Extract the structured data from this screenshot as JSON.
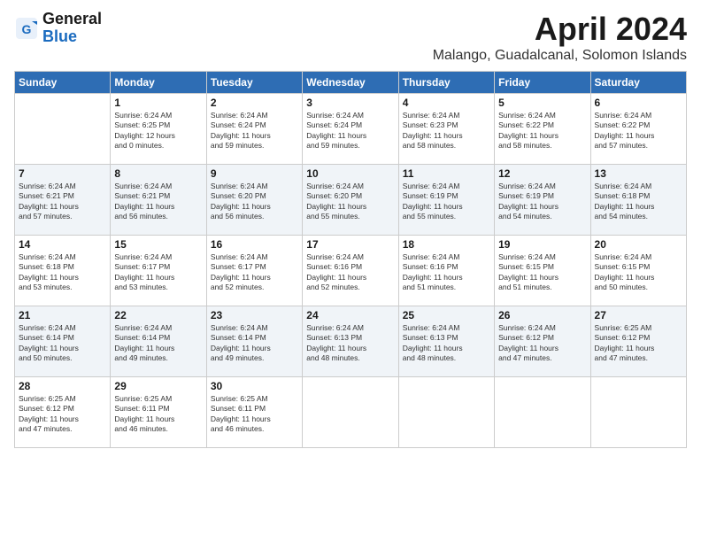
{
  "header": {
    "logo_general": "General",
    "logo_blue": "Blue",
    "month_title": "April 2024",
    "location": "Malango, Guadalcanal, Solomon Islands"
  },
  "weekdays": [
    "Sunday",
    "Monday",
    "Tuesday",
    "Wednesday",
    "Thursday",
    "Friday",
    "Saturday"
  ],
  "weeks": [
    [
      {
        "day": "",
        "info": ""
      },
      {
        "day": "1",
        "info": "Sunrise: 6:24 AM\nSunset: 6:25 PM\nDaylight: 12 hours\nand 0 minutes."
      },
      {
        "day": "2",
        "info": "Sunrise: 6:24 AM\nSunset: 6:24 PM\nDaylight: 11 hours\nand 59 minutes."
      },
      {
        "day": "3",
        "info": "Sunrise: 6:24 AM\nSunset: 6:24 PM\nDaylight: 11 hours\nand 59 minutes."
      },
      {
        "day": "4",
        "info": "Sunrise: 6:24 AM\nSunset: 6:23 PM\nDaylight: 11 hours\nand 58 minutes."
      },
      {
        "day": "5",
        "info": "Sunrise: 6:24 AM\nSunset: 6:22 PM\nDaylight: 11 hours\nand 58 minutes."
      },
      {
        "day": "6",
        "info": "Sunrise: 6:24 AM\nSunset: 6:22 PM\nDaylight: 11 hours\nand 57 minutes."
      }
    ],
    [
      {
        "day": "7",
        "info": "Sunrise: 6:24 AM\nSunset: 6:21 PM\nDaylight: 11 hours\nand 57 minutes."
      },
      {
        "day": "8",
        "info": "Sunrise: 6:24 AM\nSunset: 6:21 PM\nDaylight: 11 hours\nand 56 minutes."
      },
      {
        "day": "9",
        "info": "Sunrise: 6:24 AM\nSunset: 6:20 PM\nDaylight: 11 hours\nand 56 minutes."
      },
      {
        "day": "10",
        "info": "Sunrise: 6:24 AM\nSunset: 6:20 PM\nDaylight: 11 hours\nand 55 minutes."
      },
      {
        "day": "11",
        "info": "Sunrise: 6:24 AM\nSunset: 6:19 PM\nDaylight: 11 hours\nand 55 minutes."
      },
      {
        "day": "12",
        "info": "Sunrise: 6:24 AM\nSunset: 6:19 PM\nDaylight: 11 hours\nand 54 minutes."
      },
      {
        "day": "13",
        "info": "Sunrise: 6:24 AM\nSunset: 6:18 PM\nDaylight: 11 hours\nand 54 minutes."
      }
    ],
    [
      {
        "day": "14",
        "info": "Sunrise: 6:24 AM\nSunset: 6:18 PM\nDaylight: 11 hours\nand 53 minutes."
      },
      {
        "day": "15",
        "info": "Sunrise: 6:24 AM\nSunset: 6:17 PM\nDaylight: 11 hours\nand 53 minutes."
      },
      {
        "day": "16",
        "info": "Sunrise: 6:24 AM\nSunset: 6:17 PM\nDaylight: 11 hours\nand 52 minutes."
      },
      {
        "day": "17",
        "info": "Sunrise: 6:24 AM\nSunset: 6:16 PM\nDaylight: 11 hours\nand 52 minutes."
      },
      {
        "day": "18",
        "info": "Sunrise: 6:24 AM\nSunset: 6:16 PM\nDaylight: 11 hours\nand 51 minutes."
      },
      {
        "day": "19",
        "info": "Sunrise: 6:24 AM\nSunset: 6:15 PM\nDaylight: 11 hours\nand 51 minutes."
      },
      {
        "day": "20",
        "info": "Sunrise: 6:24 AM\nSunset: 6:15 PM\nDaylight: 11 hours\nand 50 minutes."
      }
    ],
    [
      {
        "day": "21",
        "info": "Sunrise: 6:24 AM\nSunset: 6:14 PM\nDaylight: 11 hours\nand 50 minutes."
      },
      {
        "day": "22",
        "info": "Sunrise: 6:24 AM\nSunset: 6:14 PM\nDaylight: 11 hours\nand 49 minutes."
      },
      {
        "day": "23",
        "info": "Sunrise: 6:24 AM\nSunset: 6:14 PM\nDaylight: 11 hours\nand 49 minutes."
      },
      {
        "day": "24",
        "info": "Sunrise: 6:24 AM\nSunset: 6:13 PM\nDaylight: 11 hours\nand 48 minutes."
      },
      {
        "day": "25",
        "info": "Sunrise: 6:24 AM\nSunset: 6:13 PM\nDaylight: 11 hours\nand 48 minutes."
      },
      {
        "day": "26",
        "info": "Sunrise: 6:24 AM\nSunset: 6:12 PM\nDaylight: 11 hours\nand 47 minutes."
      },
      {
        "day": "27",
        "info": "Sunrise: 6:25 AM\nSunset: 6:12 PM\nDaylight: 11 hours\nand 47 minutes."
      }
    ],
    [
      {
        "day": "28",
        "info": "Sunrise: 6:25 AM\nSunset: 6:12 PM\nDaylight: 11 hours\nand 47 minutes."
      },
      {
        "day": "29",
        "info": "Sunrise: 6:25 AM\nSunset: 6:11 PM\nDaylight: 11 hours\nand 46 minutes."
      },
      {
        "day": "30",
        "info": "Sunrise: 6:25 AM\nSunset: 6:11 PM\nDaylight: 11 hours\nand 46 minutes."
      },
      {
        "day": "",
        "info": ""
      },
      {
        "day": "",
        "info": ""
      },
      {
        "day": "",
        "info": ""
      },
      {
        "day": "",
        "info": ""
      }
    ]
  ]
}
